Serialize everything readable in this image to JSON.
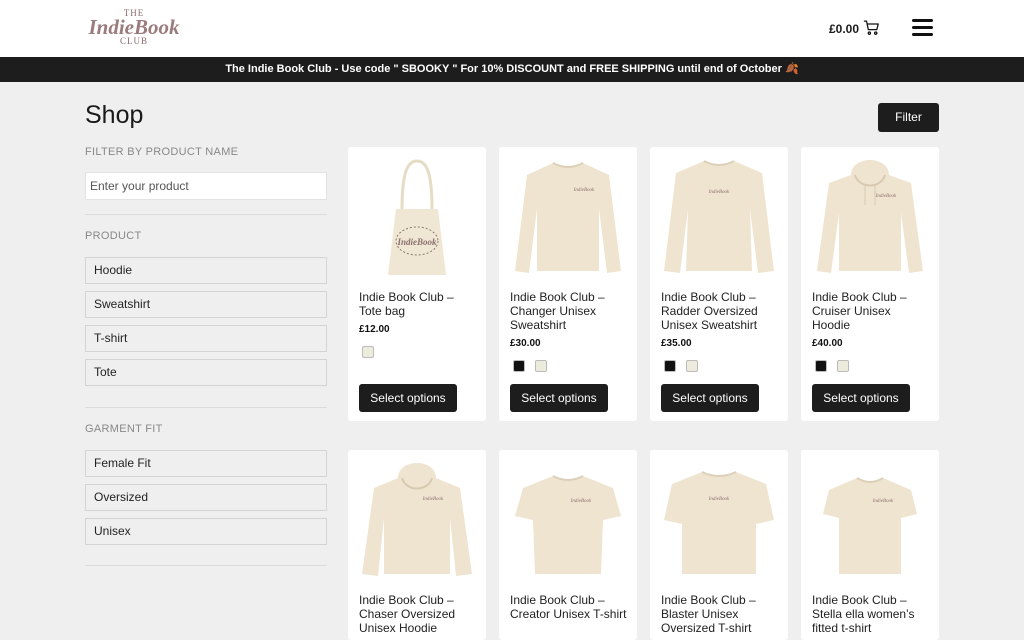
{
  "header": {
    "logo": {
      "the": "THE",
      "brand": "IndieBook",
      "club": "CLUB"
    },
    "cart_total": "£0.00",
    "icons": [
      "cart-icon",
      "hamburger-menu-icon"
    ]
  },
  "promo_banner": "The Indie Book Club - Use code \" SBOOKY \" For 10% DISCOUNT and FREE SHIPPING until end of October 🍂",
  "page": {
    "title": "Shop",
    "filter_button": "Filter"
  },
  "sidebar": {
    "filter_name_heading": "FILTER BY PRODUCT NAME",
    "search_placeholder": "Enter your product",
    "product_heading": "PRODUCT",
    "product_options": [
      "Hoodie",
      "Sweatshirt",
      "T-shirt",
      "Tote"
    ],
    "fit_heading": "GARMENT FIT",
    "fit_options": [
      "Female Fit",
      "Oversized",
      "Unisex"
    ]
  },
  "colors": {
    "black_swatch": "#111111",
    "natural_swatch": "#ecebdc",
    "garment": "#efe4d0",
    "dark": "#1d1d1d"
  },
  "products": [
    {
      "name": "Indie Book Club – Tote bag",
      "price": "£12.00",
      "swatches": [
        "natural"
      ],
      "button": "Select options"
    },
    {
      "name": "Indie Book Club – Changer Unisex Sweatshirt",
      "price": "£30.00",
      "swatches": [
        "black",
        "natural"
      ],
      "button": "Select options"
    },
    {
      "name": "Indie Book Club – Radder Oversized Unisex Sweatshirt",
      "price": "£35.00",
      "swatches": [
        "black",
        "natural"
      ],
      "button": "Select options"
    },
    {
      "name": "Indie Book Club – Cruiser Unisex Hoodie",
      "price": "£40.00",
      "swatches": [
        "black",
        "natural"
      ],
      "button": "Select options"
    },
    {
      "name": "Indie Book Club – Chaser Oversized Unisex Hoodie"
    },
    {
      "name": "Indie Book Club – Creator Unisex T-shirt"
    },
    {
      "name": "Indie Book Club – Blaster Unisex Oversized T-shirt"
    },
    {
      "name": "Indie Book Club – Stella ella women’s fitted t-shirt"
    }
  ]
}
